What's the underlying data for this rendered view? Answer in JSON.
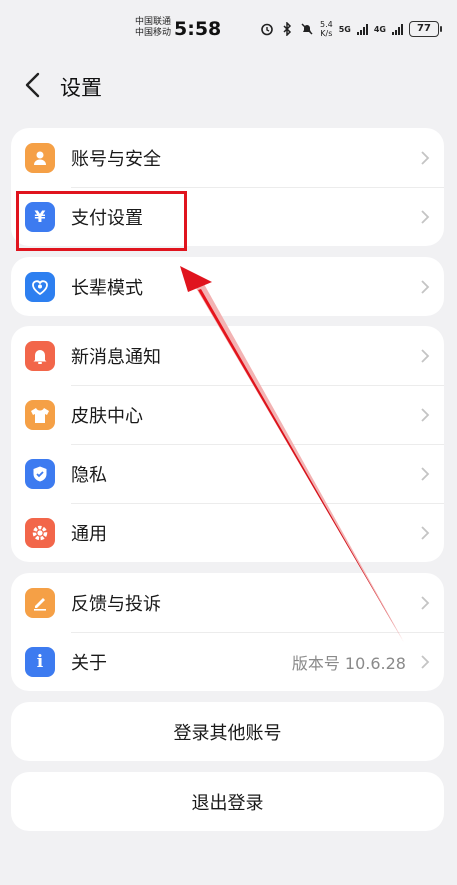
{
  "status_bar": {
    "carrier_1": "中国联通",
    "carrier_2": "中国移动",
    "time": "5:58",
    "speed_value": "5.4",
    "speed_unit": "K/s",
    "net_1": "5G",
    "net_2": "4G",
    "battery": "77"
  },
  "header": {
    "title": "设置"
  },
  "group1": {
    "items": [
      {
        "label": "账号与安全",
        "icon": "person-icon",
        "color": "#f5a046"
      },
      {
        "label": "支付设置",
        "icon": "yuan-icon",
        "color": "#3d7bf0"
      }
    ]
  },
  "group2": {
    "items": [
      {
        "label": "长辈模式",
        "icon": "heart-icon",
        "color": "#2d7ff0"
      }
    ]
  },
  "group3": {
    "items": [
      {
        "label": "新消息通知",
        "icon": "bell-icon",
        "color": "#f2664a"
      },
      {
        "label": "皮肤中心",
        "icon": "shirt-icon",
        "color": "#f5a046"
      },
      {
        "label": "隐私",
        "icon": "shield-icon",
        "color": "#3d7bf0"
      },
      {
        "label": "通用",
        "icon": "gear-icon",
        "color": "#f2664a"
      }
    ]
  },
  "group4": {
    "items": [
      {
        "label": "反馈与投诉",
        "icon": "pencil-icon",
        "color": "#f5a046"
      },
      {
        "label": "关于",
        "icon": "info-icon",
        "color": "#3d7bf0",
        "value": "版本号 10.6.28"
      }
    ]
  },
  "buttons": {
    "switch_account": "登录其他账号",
    "logout": "退出登录"
  },
  "annotation": {
    "color": "#e0141e"
  }
}
